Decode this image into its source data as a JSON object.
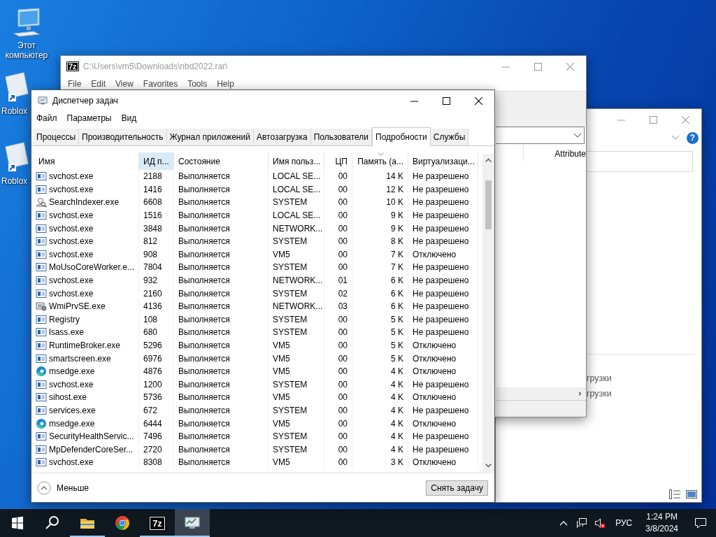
{
  "desktop_icons": [
    {
      "kind": "computer",
      "label": "Этот компьютер"
    },
    {
      "kind": "shortcut",
      "label": "Roblox"
    },
    {
      "kind": "shortcut",
      "label": "Roblox"
    }
  ],
  "explorer_window": {
    "help_button": "?",
    "nav_items": [
      {
        "label": "грузки"
      },
      {
        "label": "грузки"
      }
    ]
  },
  "archive_window": {
    "icon_text": "7z",
    "title": "C:\\Users\\vm5\\Downloads\\nbd2022.rar\\",
    "menu": [
      "File",
      "Edit",
      "View",
      "Favorites",
      "Tools",
      "Help"
    ],
    "columns": [
      "Attribute"
    ]
  },
  "task_manager": {
    "title": "Диспетчер задач",
    "menu": [
      "Файл",
      "Параметры",
      "Вид"
    ],
    "tabs": [
      {
        "label": "Процессы",
        "selected": false
      },
      {
        "label": "Производительность",
        "selected": false
      },
      {
        "label": "Журнал приложений",
        "selected": false
      },
      {
        "label": "Автозагрузка",
        "selected": false
      },
      {
        "label": "Пользователи",
        "selected": false
      },
      {
        "label": "Подробности",
        "selected": true
      },
      {
        "label": "Службы",
        "selected": false
      }
    ],
    "columns": [
      {
        "label": "Имя",
        "hovered": false,
        "sorted": false
      },
      {
        "label": "ИД п...",
        "hovered": true,
        "sorted": false
      },
      {
        "label": "Состояние",
        "hovered": false,
        "sorted": false
      },
      {
        "label": "Имя польз...",
        "hovered": false,
        "sorted": false
      },
      {
        "label": "ЦП",
        "hovered": false,
        "sorted": false
      },
      {
        "label": "Память (а...",
        "hovered": false,
        "sorted": true
      },
      {
        "label": "Виртуализаци...",
        "hovered": false,
        "sorted": false
      }
    ],
    "rows": [
      {
        "kind": "window",
        "cells": [
          "svchost.exe",
          "2188",
          "Выполняется",
          "LOCAL SE...",
          "00",
          "14 K",
          "Не разрешено"
        ]
      },
      {
        "kind": "window",
        "cells": [
          "svchost.exe",
          "1416",
          "Выполняется",
          "LOCAL SE...",
          "00",
          "12 K",
          "Не разрешено"
        ]
      },
      {
        "kind": "indexer",
        "cells": [
          "SearchIndexer.exe",
          "6608",
          "Выполняется",
          "SYSTEM",
          "00",
          "10 K",
          "Не разрешено"
        ]
      },
      {
        "kind": "window",
        "cells": [
          "svchost.exe",
          "1516",
          "Выполняется",
          "LOCAL SE...",
          "00",
          "9 K",
          "Не разрешено"
        ]
      },
      {
        "kind": "window",
        "cells": [
          "svchost.exe",
          "3848",
          "Выполняется",
          "NETWORK...",
          "00",
          "9 K",
          "Не разрешено"
        ]
      },
      {
        "kind": "window",
        "cells": [
          "svchost.exe",
          "812",
          "Выполняется",
          "SYSTEM",
          "00",
          "8 K",
          "Не разрешено"
        ]
      },
      {
        "kind": "window",
        "cells": [
          "svchost.exe",
          "908",
          "Выполняется",
          "VM5",
          "00",
          "7 K",
          "Отключено"
        ]
      },
      {
        "kind": "window",
        "cells": [
          "MoUsoCoreWorker.e...",
          "7804",
          "Выполняется",
          "SYSTEM",
          "00",
          "7 K",
          "Не разрешено"
        ]
      },
      {
        "kind": "window",
        "cells": [
          "svchost.exe",
          "932",
          "Выполняется",
          "NETWORK...",
          "01",
          "6 K",
          "Не разрешено"
        ]
      },
      {
        "kind": "window",
        "cells": [
          "svchost.exe",
          "2160",
          "Выполняется",
          "SYSTEM",
          "02",
          "6 K",
          "Не разрешено"
        ]
      },
      {
        "kind": "wmi",
        "cells": [
          "WmiPrvSE.exe",
          "4136",
          "Выполняется",
          "NETWORK...",
          "03",
          "6 K",
          "Не разрешено"
        ]
      },
      {
        "kind": "window",
        "cells": [
          "Registry",
          "108",
          "Выполняется",
          "SYSTEM",
          "00",
          "5 K",
          "Не разрешено"
        ]
      },
      {
        "kind": "window",
        "cells": [
          "lsass.exe",
          "680",
          "Выполняется",
          "SYSTEM",
          "00",
          "5 K",
          "Не разрешено"
        ]
      },
      {
        "kind": "window",
        "cells": [
          "RuntimeBroker.exe",
          "5296",
          "Выполняется",
          "VM5",
          "00",
          "5 K",
          "Отключено"
        ]
      },
      {
        "kind": "window",
        "cells": [
          "smartscreen.exe",
          "6976",
          "Выполняется",
          "VM5",
          "00",
          "5 K",
          "Отключено"
        ]
      },
      {
        "kind": "edge",
        "cells": [
          "msedge.exe",
          "4876",
          "Выполняется",
          "VM5",
          "00",
          "4 K",
          "Отключено"
        ]
      },
      {
        "kind": "window",
        "cells": [
          "svchost.exe",
          "1200",
          "Выполняется",
          "SYSTEM",
          "00",
          "4 K",
          "Не разрешено"
        ]
      },
      {
        "kind": "window",
        "cells": [
          "sihost.exe",
          "5736",
          "Выполняется",
          "VM5",
          "00",
          "4 K",
          "Отключено"
        ]
      },
      {
        "kind": "window",
        "cells": [
          "services.exe",
          "672",
          "Выполняется",
          "SYSTEM",
          "00",
          "4 K",
          "Не разрешено"
        ]
      },
      {
        "kind": "edge",
        "cells": [
          "msedge.exe",
          "6444",
          "Выполняется",
          "VM5",
          "00",
          "4 K",
          "Отключено"
        ]
      },
      {
        "kind": "window",
        "cells": [
          "SecurityHealthServic...",
          "7496",
          "Выполняется",
          "SYSTEM",
          "00",
          "4 K",
          "Не разрешено"
        ]
      },
      {
        "kind": "window",
        "cells": [
          "MpDefenderCoreSer...",
          "2720",
          "Выполняется",
          "SYSTEM",
          "00",
          "4 K",
          "Не разрешено"
        ]
      },
      {
        "kind": "window",
        "cells": [
          "svchost.exe",
          "8308",
          "Выполняется",
          "VM5",
          "00",
          "3 K",
          "Отключено"
        ]
      }
    ],
    "fewer_details": "Меньше",
    "end_task_button": "Снять задачу"
  },
  "taskbar": {
    "apps": [
      {
        "kind": "folder",
        "running": true,
        "active": false
      },
      {
        "kind": "chrome",
        "running": false,
        "active": false
      },
      {
        "kind": "archiver",
        "label": "7z",
        "running": true,
        "active": false
      },
      {
        "kind": "monitor",
        "running": true,
        "active": true
      }
    ],
    "tray": {
      "language": "РУС",
      "time": "1:24 PM",
      "date": "3/8/2024"
    }
  }
}
